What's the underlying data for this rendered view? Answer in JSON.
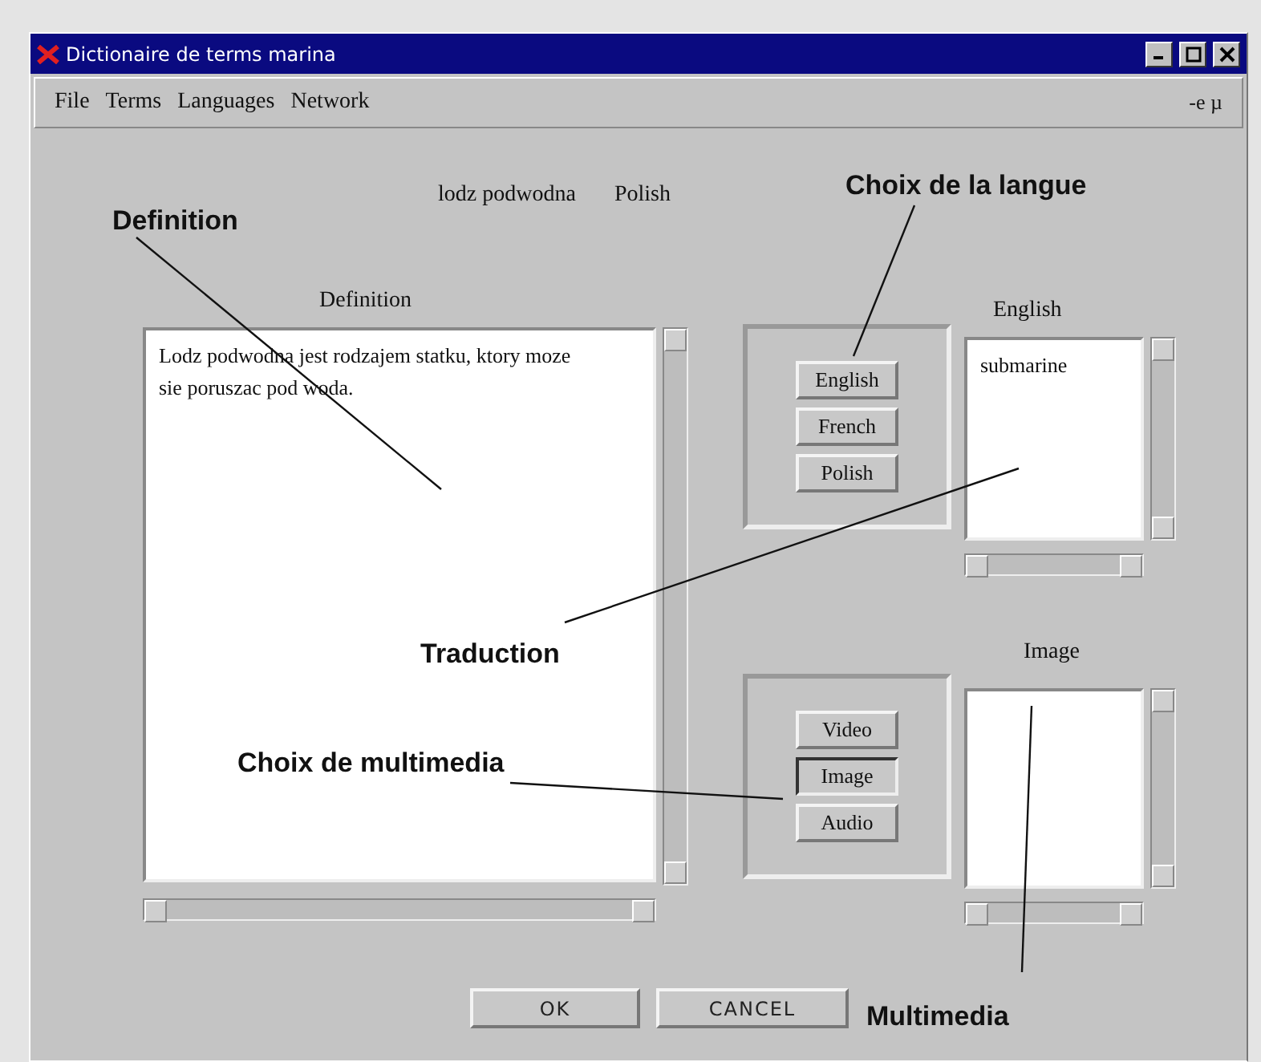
{
  "window": {
    "title": "Dictionaire de terms marina"
  },
  "menu": [
    "File",
    "Terms",
    "Languages",
    "Network"
  ],
  "menu_right": "-e µ",
  "term": {
    "word": "lodz podwodna",
    "language": "Polish"
  },
  "definition": {
    "label": "Definition",
    "text": "Lodz podwodna jest rodzajem statku, ktory moze sie poruszac pod woda."
  },
  "language_buttons": [
    {
      "label": "English",
      "selected": false
    },
    {
      "label": "French",
      "selected": false
    },
    {
      "label": "Polish",
      "selected": false
    }
  ],
  "translation": {
    "label": "English",
    "items": [
      "submarine"
    ]
  },
  "media_buttons": [
    {
      "label": "Video",
      "selected": false
    },
    {
      "label": "Image",
      "selected": true
    },
    {
      "label": "Audio",
      "selected": false
    }
  ],
  "media": {
    "label": "Image"
  },
  "buttons": [
    "OK",
    "CANCEL"
  ],
  "annotations": [
    "Definition",
    "Choix de la langue",
    "Traduction",
    "Choix de multimedia",
    "Multimedia"
  ]
}
